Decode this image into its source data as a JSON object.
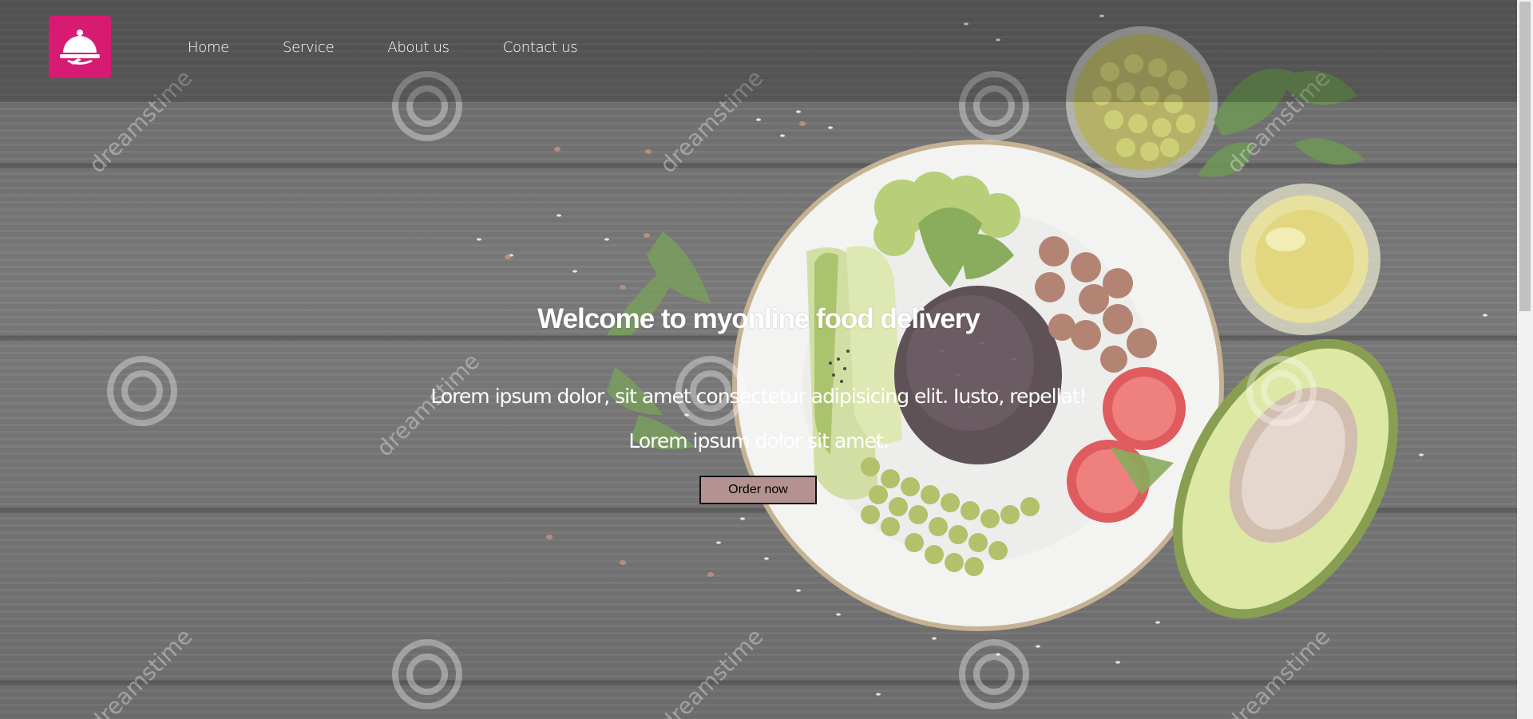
{
  "nav": {
    "logo_icon": "food-cloche-icon",
    "links": [
      {
        "label": "Home"
      },
      {
        "label": "Service"
      },
      {
        "label": "About us"
      },
      {
        "label": "Contact us"
      }
    ]
  },
  "hero": {
    "title": "Welcome to myonline food delivery",
    "line1": "Lorem ipsum dolor, sit amet consectetur adipisicing elit. Iusto, repellat!",
    "line2": "Lorem ipsum dolor sit amet.",
    "button_label": "Order now"
  },
  "watermark": {
    "text": "dreamstime"
  },
  "colors": {
    "logo_bg": "#d81b72",
    "button_bg": "#b59292",
    "background": "#545454"
  }
}
